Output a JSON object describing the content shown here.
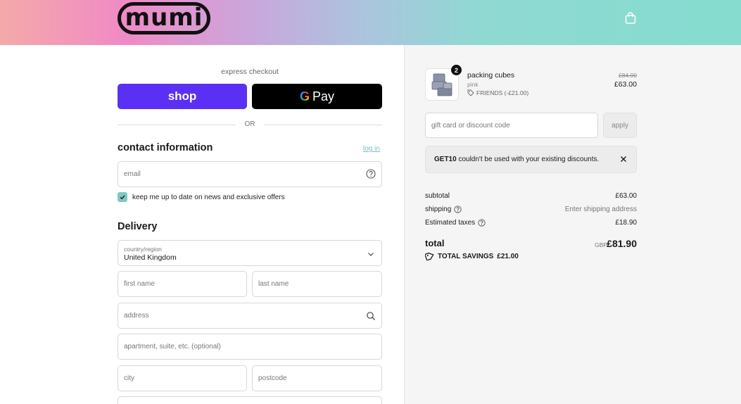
{
  "header": {
    "logo_text": "mumi",
    "cart_icon": "shopping-bag-icon",
    "gradient": [
      "#f4a9a8",
      "#f08ac6",
      "#c7a9dd",
      "#8fd9d2"
    ]
  },
  "express": {
    "label": "express checkout",
    "shop_label": "shop",
    "gpay_g": "G",
    "gpay_label": "Pay",
    "or_label": "OR",
    "shop_color": "#5a31f4"
  },
  "contact": {
    "title": "contact information",
    "login_label": "log in",
    "email_placeholder": "email",
    "newsletter_label": "keep me up to date on news and exclusive offers",
    "newsletter_checked": true
  },
  "delivery": {
    "title": "Delivery",
    "country_label": "country/region",
    "country_value": "United Kingdom",
    "first_name_placeholder": "first name",
    "last_name_placeholder": "last name",
    "address_placeholder": "address",
    "apartment_placeholder": "apartment, suite, etc. (optional)",
    "city_placeholder": "city",
    "postcode_placeholder": "postcode"
  },
  "order": {
    "item": {
      "quantity": "2",
      "name": "packing cubes",
      "variant": "pink",
      "discount": "FRIENDS (-£21.00)",
      "original_price": "£84.00",
      "price": "£63.00"
    },
    "discount_placeholder": "gift card or discount code",
    "apply_label": "apply",
    "notice_code": "GET10",
    "notice_text": " couldn't be used with your existing discounts.",
    "subtotal_label": "subtotal",
    "subtotal_value": "£63.00",
    "shipping_label": "shipping",
    "shipping_value": "Enter shipping address",
    "taxes_label": "Estimated taxes",
    "taxes_value": "£18.90",
    "total_label": "total",
    "total_currency": "GBP",
    "total_value": "£81.90",
    "savings_label": "TOTAL SAVINGS",
    "savings_value": "£21.00"
  }
}
